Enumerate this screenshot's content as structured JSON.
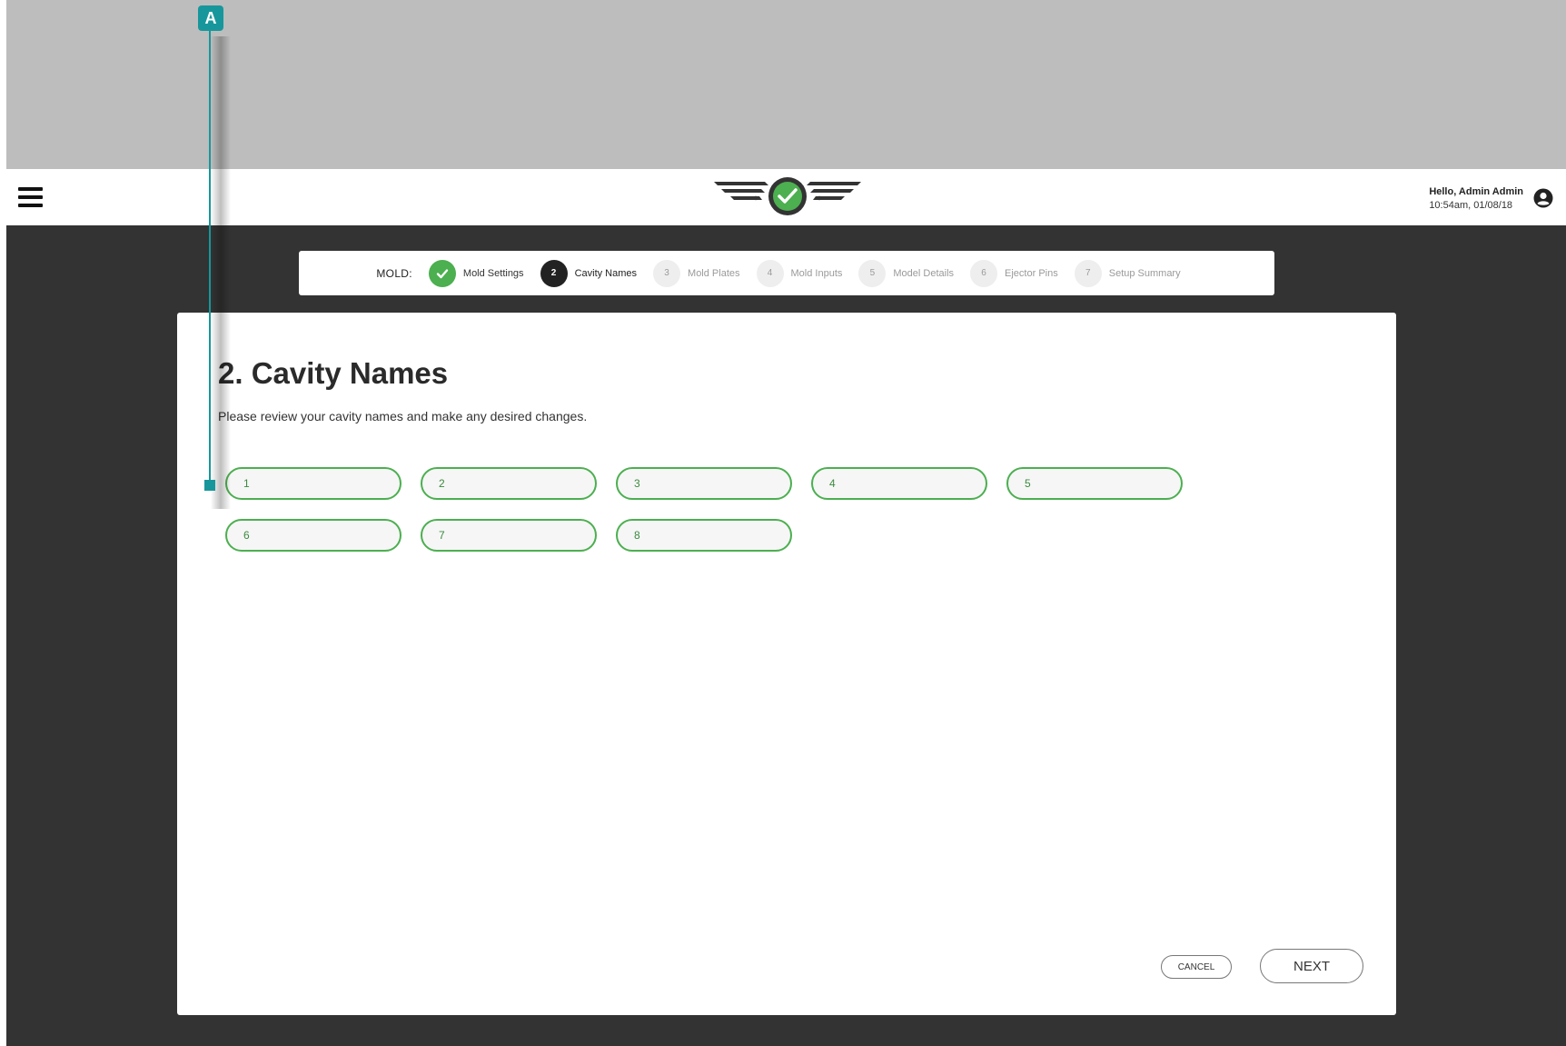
{
  "header": {
    "greeting": "Hello, Admin Admin",
    "datetime": "10:54am, 01/08/18"
  },
  "stepper": {
    "label": "MOLD:",
    "steps": [
      {
        "number": "",
        "name": "Mold Settings",
        "state": "done"
      },
      {
        "number": "2",
        "name": "Cavity Names",
        "state": "current"
      },
      {
        "number": "3",
        "name": "Mold Plates",
        "state": "todo"
      },
      {
        "number": "4",
        "name": "Mold Inputs",
        "state": "todo"
      },
      {
        "number": "5",
        "name": "Model Details",
        "state": "todo"
      },
      {
        "number": "6",
        "name": "Ejector Pins",
        "state": "todo"
      },
      {
        "number": "7",
        "name": "Setup Summary",
        "state": "todo"
      }
    ]
  },
  "main": {
    "title": "2. Cavity Names",
    "subtitle": "Please review your cavity names and make any desired changes.",
    "cavities": [
      "1",
      "2",
      "3",
      "4",
      "5",
      "6",
      "7",
      "8"
    ]
  },
  "actions": {
    "cancel_label": "CANCEL",
    "next_label": "NEXT"
  },
  "annotation": {
    "badge": "A"
  },
  "colors": {
    "accent_green": "#4caf50",
    "annotation_teal": "#17979b",
    "dark_background": "#333333"
  }
}
